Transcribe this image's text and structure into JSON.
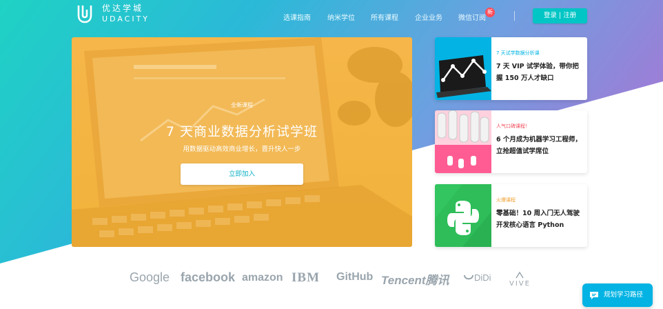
{
  "brand": {
    "name_cn": "优达学城",
    "name_en": "UDACITY"
  },
  "nav": {
    "items": [
      {
        "label": "选课指南"
      },
      {
        "label": "纳米学位"
      },
      {
        "label": "所有课程"
      },
      {
        "label": "企业业务"
      },
      {
        "label": "微信订阅"
      }
    ],
    "badge": "新",
    "login_label": "登录 | 注册"
  },
  "banner": {
    "tag": "全新课程",
    "title": "7 天商业数据分析试学班",
    "subtitle": "用数据驱动高效商业增长，晋升快人一步",
    "button": "立即加入"
  },
  "cards": [
    {
      "tag": "7 天试学数据分析课",
      "title": "7 天 VIP 试学体验，带你把握 150 万人才缺口",
      "tag_color": "#02b3e4"
    },
    {
      "tag": "人气口碑课程！",
      "title": "6 个月成为机器学习工程师，立抢超值试学席位",
      "tag_color": "#f04b5a"
    },
    {
      "tag": "火爆课程",
      "title": "零基础！10 周入门无人驾驶开发核心语言 Python",
      "tag_color": "#f0a032"
    }
  ],
  "partners": [
    "Google",
    "facebook",
    "amazon",
    "IBM",
    "GitHub",
    "Tencent腾讯",
    "DiDi",
    "VIVE"
  ],
  "chat": {
    "label": "规划学习路径"
  },
  "colors": {
    "teal": "#02c5c5",
    "blue": "#02b3e4",
    "purple": "#9b6fd6",
    "banner_orange": "#f6b64a",
    "badge_red": "#ff4d5a"
  }
}
